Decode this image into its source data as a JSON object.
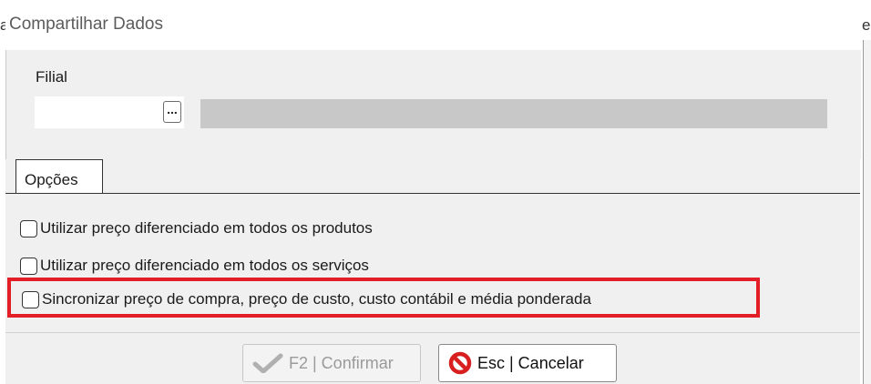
{
  "dialog": {
    "title": "Compartilhar Dados",
    "filial": {
      "label": "Filial",
      "code_value": "",
      "lookup_button": "...",
      "description_value": ""
    },
    "tabs": [
      {
        "label": "Opções"
      }
    ],
    "options": [
      {
        "label": "Utilizar preço diferenciado em todos os produtos",
        "checked": false
      },
      {
        "label": "Utilizar preço diferenciado em todos os serviços",
        "checked": false
      },
      {
        "label": "Sincronizar preço de compra, preço de custo, custo contábil e média ponderada",
        "checked": false,
        "highlighted": true
      }
    ],
    "buttons": {
      "confirm_label": "F2 | Confirmar",
      "confirm_enabled": false,
      "cancel_label": "Esc | Cancelar"
    }
  },
  "colors": {
    "highlight_border": "#e41e26",
    "cancel_icon": "#d81e1e",
    "check_icon_disabled": "#b0b0b0"
  },
  "background_window": {
    "left_text_fragment": "a",
    "right_text_fragment": "e"
  }
}
